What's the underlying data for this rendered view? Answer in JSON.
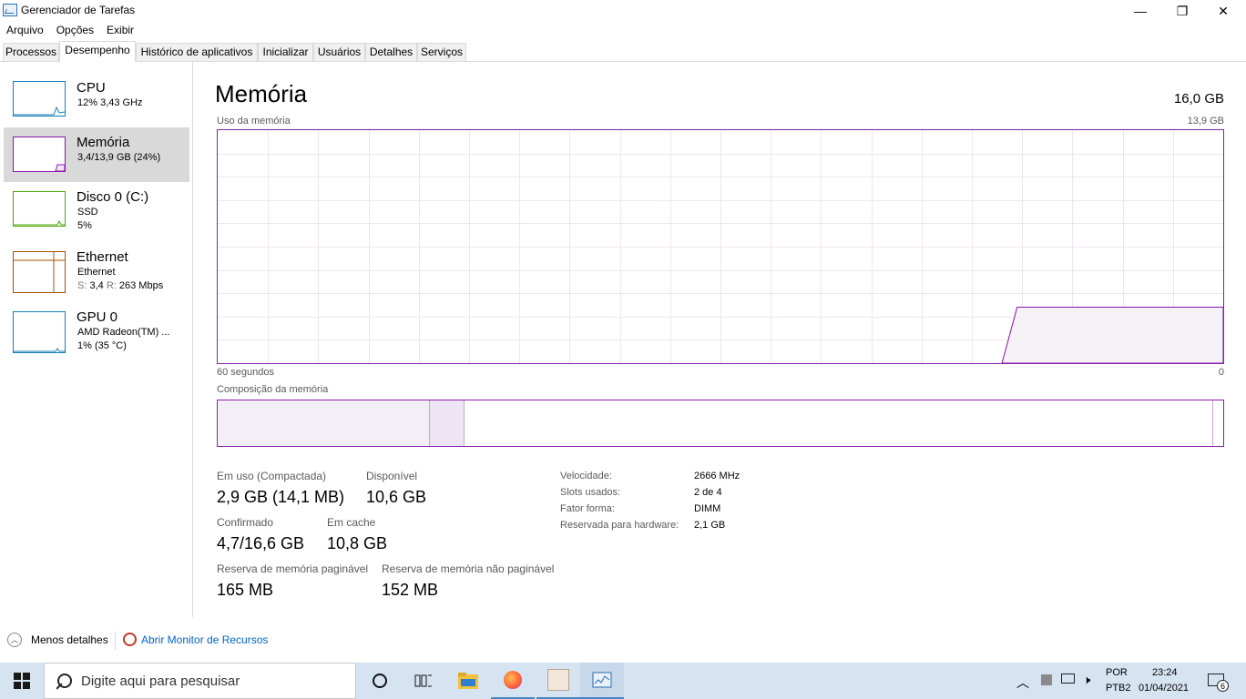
{
  "window": {
    "title": "Gerenciador de Tarefas",
    "controls": {
      "minimize": "—",
      "restore": "❐",
      "close": "✕"
    }
  },
  "menu": [
    "Arquivo",
    "Opções",
    "Exibir"
  ],
  "tabs": [
    "Processos",
    "Desempenho",
    "Histórico de aplicativos",
    "Inicializar",
    "Usuários",
    "Detalhes",
    "Serviços"
  ],
  "active_tab": "Desempenho",
  "sidebar": [
    {
      "name": "CPU",
      "line1": "12% 3,43 GHz",
      "line2": "",
      "color": "#117dbb"
    },
    {
      "name": "Memória",
      "line1": "3,4/13,9 GB (24%)",
      "line2": "",
      "color": "#8b12ae"
    },
    {
      "name": "Disco 0 (C:)",
      "line1": "SSD",
      "line2": "5%",
      "color": "#4da60c"
    },
    {
      "name": "Ethernet",
      "line1": "Ethernet",
      "line2_label_s": "S:",
      "line2_s": "3,4",
      "line2_label_r": "R:",
      "line2_r": "263 Mbps",
      "color": "#a74f01"
    },
    {
      "name": "GPU 0",
      "line1": "AMD Radeon(TM) ...",
      "line2": "1% (35 °C)",
      "color": "#117dbb"
    }
  ],
  "main": {
    "title": "Memória",
    "total": "16,0 GB",
    "graph_label": "Uso da memória",
    "graph_max": "13,9 GB",
    "graph_time_left": "60 segundos",
    "graph_time_right": "0",
    "composition_label": "Composição da memória",
    "stats": {
      "in_use_label": "Em uso (Compactada)",
      "in_use_value": "2,9 GB (14,1 MB)",
      "available_label": "Disponível",
      "available_value": "10,6 GB",
      "committed_label": "Confirmado",
      "committed_value": "4,7/16,6 GB",
      "cached_label": "Em cache",
      "cached_value": "10,8 GB",
      "paged_label": "Reserva de memória paginável",
      "paged_value": "165 MB",
      "nonpaged_label": "Reserva de memória não paginável",
      "nonpaged_value": "152 MB"
    },
    "details": [
      {
        "label": "Velocidade:",
        "value": "2666 MHz"
      },
      {
        "label": "Slots usados:",
        "value": "2 de 4"
      },
      {
        "label": "Fator forma:",
        "value": "DIMM"
      },
      {
        "label": "Reservada para hardware:",
        "value": "2,1 GB"
      }
    ],
    "graph_usage_fraction_recent": 0.24
  },
  "footer": {
    "less_details": "Menos detalhes",
    "resource_monitor": "Abrir Monitor de Recursos"
  },
  "taskbar": {
    "search_placeholder": "Digite aqui para pesquisar",
    "lang1": "POR",
    "lang2": "PTB2",
    "time": "23:24",
    "date": "01/04/2021",
    "notifications": "6"
  },
  "colors": {
    "memory_accent": "#8b12ae",
    "graph_fill": "#f4f2f4"
  }
}
